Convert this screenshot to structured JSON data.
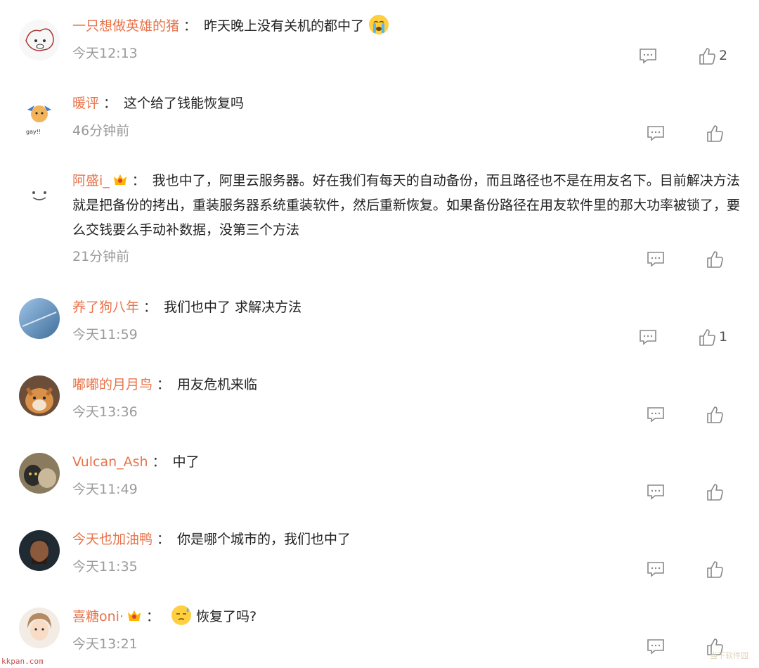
{
  "colors": {
    "username": "#e8734a",
    "time": "#9a9a9a",
    "text": "#222222",
    "icon": "#888888"
  },
  "separator": "：",
  "comments": [
    {
      "user": "一只想做英雄的猪",
      "text": "昨天晚上没有关机的都中了",
      "time": "今天12:13",
      "likes": "2",
      "badge": false,
      "emoji_after": "crying-face"
    },
    {
      "user": "暖评",
      "text": "这个给了钱能恢复吗",
      "time": "46分钟前",
      "likes": "",
      "badge": false
    },
    {
      "user": "阿盛i_",
      "text": "我也中了，阿里云服务器。好在我们有每天的自动备份，而且路径也不是在用友名下。目前解决方法就是把备份的拷出，重装服务器系统重装软件，然后重新恢复。如果备份路径在用友软件里的那大功率被锁了，要么交钱要么手动补数据，没第三个方法",
      "time": "21分钟前",
      "likes": "",
      "badge": true
    },
    {
      "user": "养了狗八年",
      "text": "我们也中了 求解决方法",
      "time": "今天11:59",
      "likes": "1",
      "badge": false
    },
    {
      "user": "嘟嘟的月月鸟",
      "text": "用友危机来临",
      "time": "今天13:36",
      "likes": "",
      "badge": false
    },
    {
      "user": "Vulcan_Ash",
      "text": "中了",
      "time": "今天11:49",
      "likes": "",
      "badge": false
    },
    {
      "user": "今天也加油鸭",
      "text": "你是哪个城市的，我们也中了",
      "time": "今天11:35",
      "likes": "",
      "badge": false
    },
    {
      "user": "喜糖oni·",
      "text": "恢复了吗?",
      "time": "今天13:21",
      "likes": "",
      "badge": true,
      "emoji_before": "sweat-face"
    }
  ],
  "watermarks": {
    "left": "kkpan.com",
    "right": "当下软件园"
  }
}
